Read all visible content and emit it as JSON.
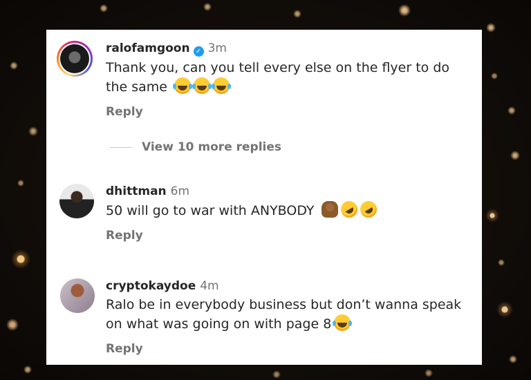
{
  "comments": [
    {
      "username": "ralofamgoon",
      "verified": true,
      "time": "3m",
      "text": "Thank you, can you tell every else on the flyer to do the same",
      "emojis": [
        "face-with-tears-of-joy",
        "face-with-tears-of-joy",
        "face-with-tears-of-joy"
      ],
      "reply_label": "Reply"
    },
    {
      "username": "dhittman",
      "verified": false,
      "time": "6m",
      "text": "50 will go to war with ANYBODY",
      "emojis": [
        "person-facepalming",
        "rolling-on-the-floor-laughing",
        "rolling-on-the-floor-laughing"
      ],
      "reply_label": "Reply"
    },
    {
      "username": "cryptokaydoe",
      "verified": false,
      "time": "4m",
      "text": "Ralo be in everybody business but don’t wanna speak on what was going on with page 8",
      "emojis": [
        "face-with-tears-of-joy"
      ],
      "reply_label": "Reply"
    }
  ],
  "view_more_label": "View 10 more replies",
  "colors": {
    "verified_badge": "#1d9bf0",
    "muted_text": "#737373",
    "primary_text": "#262626",
    "card_background": "#ffffff"
  }
}
